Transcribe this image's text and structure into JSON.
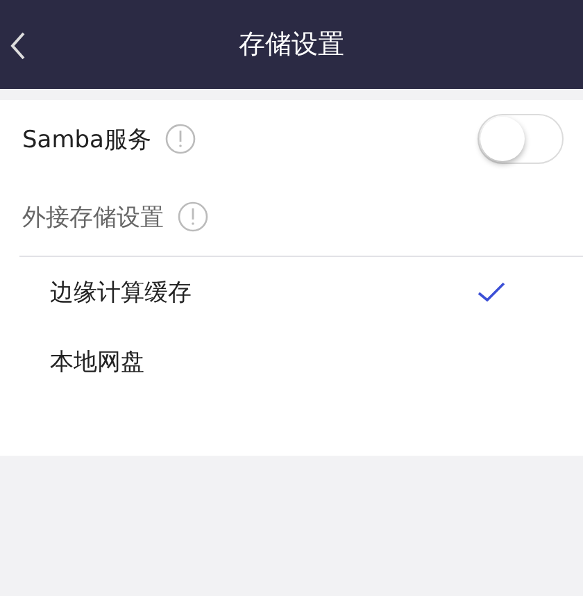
{
  "header": {
    "title": "存储设置"
  },
  "samba": {
    "label": "Samba服务",
    "on": false
  },
  "external": {
    "label": "外接存储设置"
  },
  "options": [
    {
      "label": "边缘计算缓存",
      "selected": true
    },
    {
      "label": "本地网盘",
      "selected": false
    }
  ]
}
